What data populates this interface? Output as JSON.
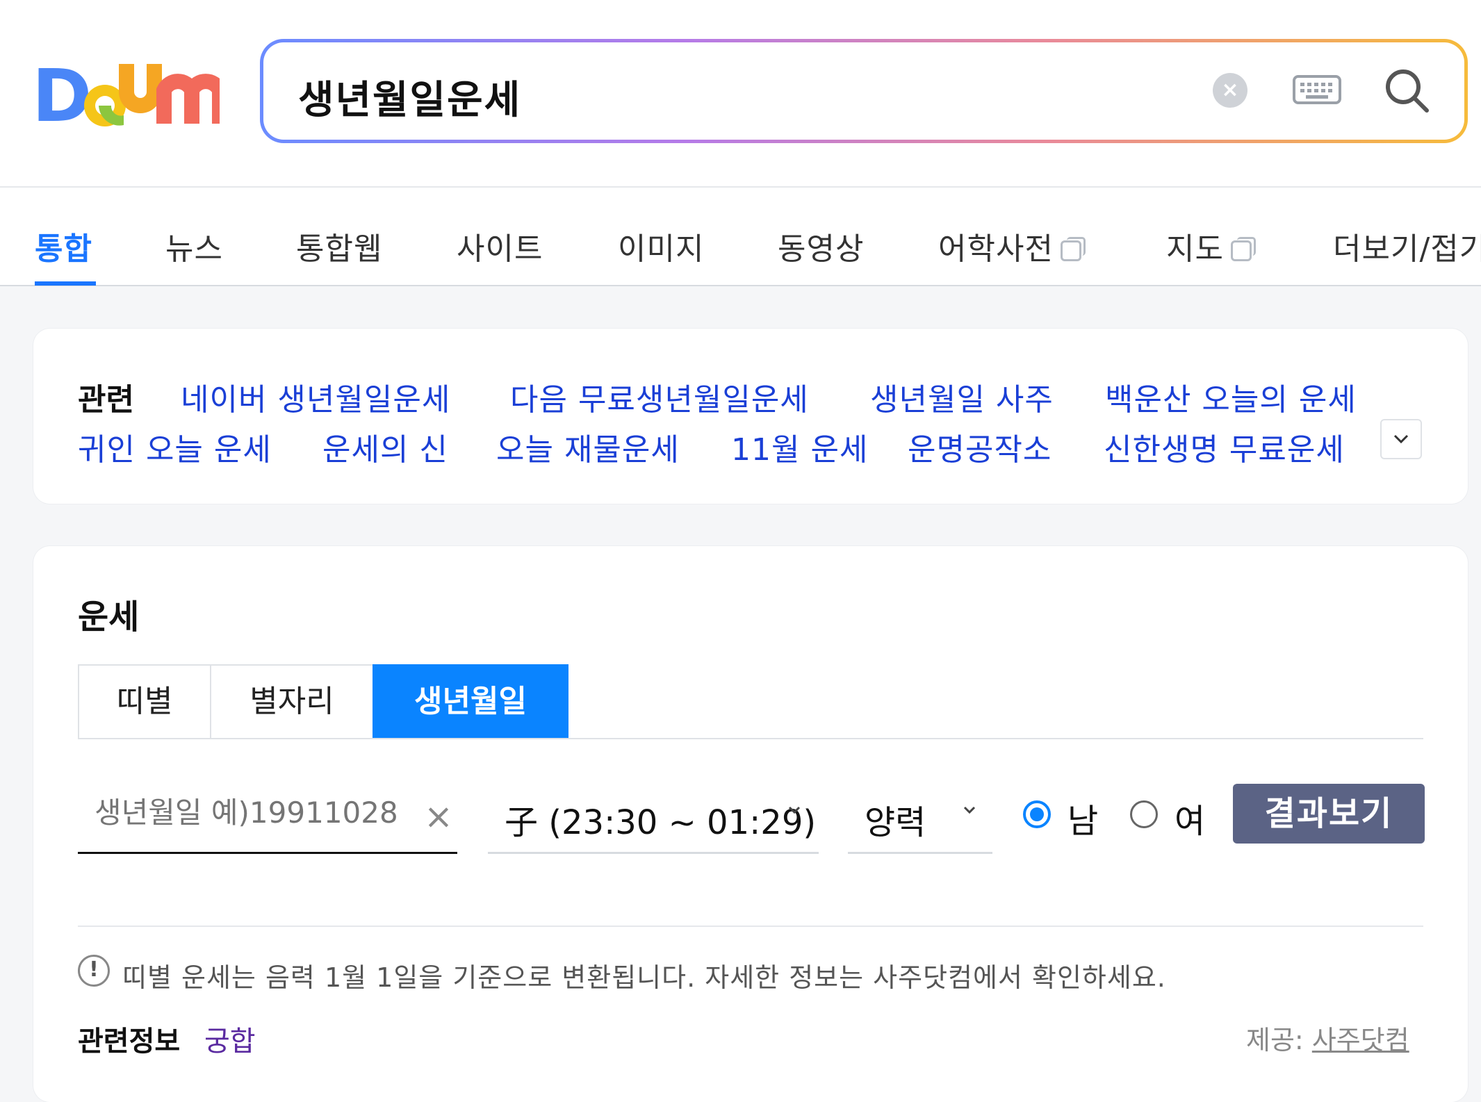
{
  "header": {
    "logo_text": "Daum",
    "search_query": "생년월일운세",
    "clear_label": "×"
  },
  "tabs": [
    {
      "label": "통합",
      "active": true
    },
    {
      "label": "뉴스"
    },
    {
      "label": "통합웹"
    },
    {
      "label": "사이트"
    },
    {
      "label": "이미지"
    },
    {
      "label": "동영상"
    },
    {
      "label": "어학사전",
      "external": true
    },
    {
      "label": "지도",
      "external": true
    },
    {
      "label": "더보기/접기"
    }
  ],
  "related": {
    "label": "관련",
    "links": [
      "네이버 생년월일운세",
      "다음 무료생년월일운세",
      "생년월일 사주",
      "백운산 오늘의 운세",
      "귀인 오늘 운세",
      "운세의 신",
      "오늘 재물운세",
      "11월 운세",
      "운명공작소",
      "신한생명 무료운세"
    ],
    "toggle_icon": "chevron-down-icon"
  },
  "fortune": {
    "title": "운세",
    "segments": [
      {
        "label": "띠별"
      },
      {
        "label": "별자리"
      },
      {
        "label": "생년월일",
        "active": true
      }
    ],
    "birth_placeholder": "생년월일 예)19911028",
    "clear_symbol": "×",
    "time_select": "子 (23:30 ~ 01:29)",
    "calendar_select": "양력",
    "gender": [
      {
        "label": "남",
        "checked": true
      },
      {
        "label": "여",
        "checked": false
      }
    ],
    "result_button": "결과보기",
    "notice_symbol": "!",
    "notice": "띠별 운세는 음력 1월 1일을 기준으로 변환됩니다. 자세한 정보는 사주닷컴에서 확인하세요.",
    "related_info_label": "관련정보",
    "related_info_link": "궁합",
    "provider_prefix": "제공:",
    "provider_link": "사주닷컴"
  },
  "colors": {
    "accent": "#1a75ff",
    "segment_active": "#0a84ff",
    "link": "#1a3fd6",
    "result_button": "#5b6385"
  }
}
